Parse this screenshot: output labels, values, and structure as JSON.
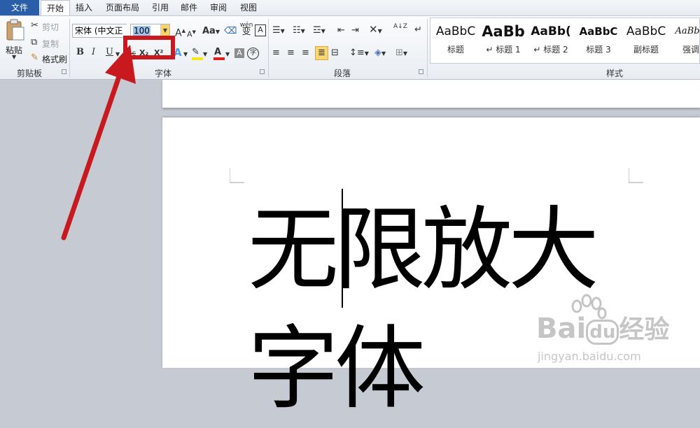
{
  "tabs": {
    "file": "文件",
    "home": "开始",
    "insert": "插入",
    "layout": "页面布局",
    "references": "引用",
    "mailings": "邮件",
    "review": "审阅",
    "view": "视图"
  },
  "clipboard": {
    "paste": "粘贴",
    "cut": "剪切",
    "copy": "复制",
    "format_painter": "格式刷",
    "group_label": "剪贴板"
  },
  "font": {
    "font_name": "宋体 (中文正",
    "font_size": "100",
    "group_label": "字体",
    "case_label": "Aa",
    "wen_label": "wén",
    "wen_char": "变",
    "border_char": "A",
    "bold": "B",
    "italic": "I",
    "underline": "U",
    "strike": "abc",
    "sub": "X₂",
    "sup": "X²",
    "effects": "A",
    "font_color": "A",
    "shade": "A",
    "enclose": "字"
  },
  "paragraph": {
    "group_label": "段落",
    "sort": "A↓Z",
    "pilcrow": "↵"
  },
  "styles": {
    "group_label": "样式",
    "items": [
      {
        "preview": "AaBbC",
        "name": "标题"
      },
      {
        "preview": "AaBb",
        "name": "↵ 标题 1"
      },
      {
        "preview": "AaBb(",
        "name": "↵ 标题 2"
      },
      {
        "preview": "AaBbC",
        "name": "标题 3"
      },
      {
        "preview": "AaBbC",
        "name": "副标题"
      },
      {
        "preview": "AaBbC",
        "name": "强调"
      }
    ]
  },
  "document": {
    "line1": "无限放大",
    "line2": "字体"
  },
  "watermark": {
    "brand_part1": "Bai",
    "brand_part2": "du",
    "brand_cn": "经验",
    "url": "jingyan.baidu.com"
  },
  "colors": {
    "accent_file_tab": "#2a5ea8",
    "highlight_red": "#c8191f",
    "selection_blue": "#9cc3ef"
  }
}
